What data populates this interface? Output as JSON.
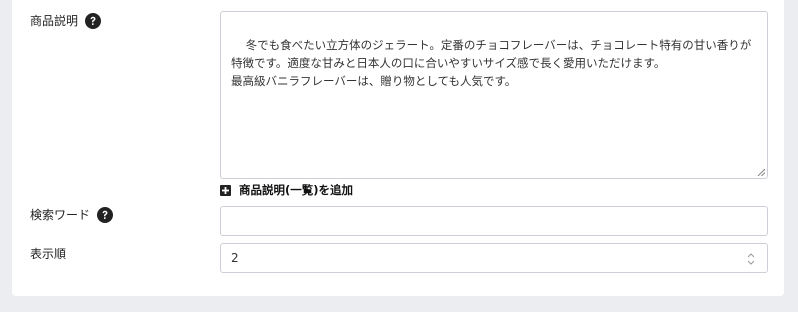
{
  "description": {
    "label": "商品説明",
    "value": "冬でも食べたい立方体のジェラート。定番のチョコフレーバーは、チョコレート特有の甘い香りが特徴です。適度な甘みと日本人の口に合いやすいサイズ感で長く愛用いただけます。\n最高級バニラフレーバーは、贈り物としても人気です。",
    "add_link_label": "商品説明(一覧)を追加"
  },
  "search_word": {
    "label": "検索ワード",
    "value": ""
  },
  "display_order": {
    "label": "表示順",
    "value": "2"
  },
  "colors": {
    "background": "#ebedf0",
    "panel": "#ffffff",
    "border": "#ccd0d6",
    "icon": "#222222"
  },
  "icons": {
    "help": "question-circle-icon",
    "add": "plus-square-icon",
    "spinner": "number-spinner-icon"
  }
}
